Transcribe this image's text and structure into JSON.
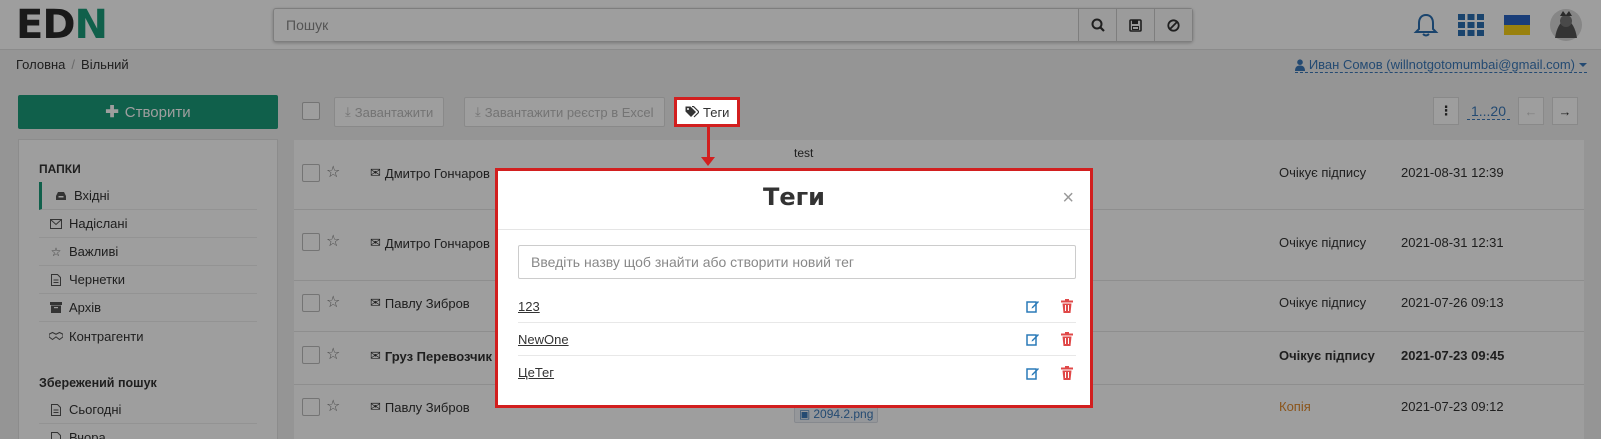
{
  "header": {
    "logo_text_ed": "ED",
    "logo_text_n": "N",
    "search_placeholder": "Пошук",
    "icons": [
      "search-icon",
      "save-icon",
      "clear-icon",
      "bell-icon",
      "apps-grid-icon",
      "ukraine-flag-icon",
      "avatar"
    ]
  },
  "breadcrumb": {
    "home": "Головна",
    "current": "Вільний"
  },
  "user": {
    "label": "Иван Сомов (willnotgotomumbai@gmail.com)"
  },
  "sidebar": {
    "create_label": "Створити",
    "folders_heading": "ПАПКИ",
    "folders": [
      {
        "label": "Вхідні",
        "icon": "inbox-icon"
      },
      {
        "label": "Надіслані",
        "icon": "envelope-icon"
      },
      {
        "label": "Важливі",
        "icon": "star-icon"
      },
      {
        "label": "Чернетки",
        "icon": "file-icon"
      },
      {
        "label": "Архів",
        "icon": "archive-icon"
      },
      {
        "label": "Контрагенти",
        "icon": "handshake-icon"
      }
    ],
    "saved_search_heading": "Збережений пошук",
    "saved_searches": [
      {
        "label": "Сьогодні",
        "icon": "file-icon"
      },
      {
        "label": "Вчора",
        "icon": "file-icon"
      }
    ]
  },
  "toolbar": {
    "download_label": "Завантажити",
    "download_excel_label": "Завантажити реєстр в Excel",
    "tags_label": "Теги",
    "page_range": "1...20"
  },
  "documents": [
    {
      "sender": "Дмитро Гончаров",
      "subject": "test",
      "status": "Очікує підпису",
      "date": "2021-08-31 12:39"
    },
    {
      "sender": "Дмитро Гончаров",
      "status": "Очікує підпису",
      "date": "2021-08-31 12:31"
    },
    {
      "sender": "Павлу Зибров",
      "status": "Очікує підпису",
      "date": "2021-07-26 09:13"
    },
    {
      "sender": "Груз Перевозчик",
      "status": "Очікує підпису",
      "date": "2021-07-23 09:45"
    },
    {
      "sender": "Павлу Зибров",
      "attachment": "2094.2.png",
      "status": "Копія",
      "date": "2021-07-23 09:12"
    }
  ],
  "modal": {
    "title": "Теги",
    "close_symbol": "×",
    "input_placeholder": "Введіть назву щоб знайти або створити новий тег",
    "tags": [
      "123",
      "NewOne",
      "ЦеТег"
    ]
  },
  "colors": {
    "brand": "#1a9b7a",
    "highlight": "#d21f1f",
    "link": "#3a78b8",
    "copy_status": "#e08a2c"
  }
}
